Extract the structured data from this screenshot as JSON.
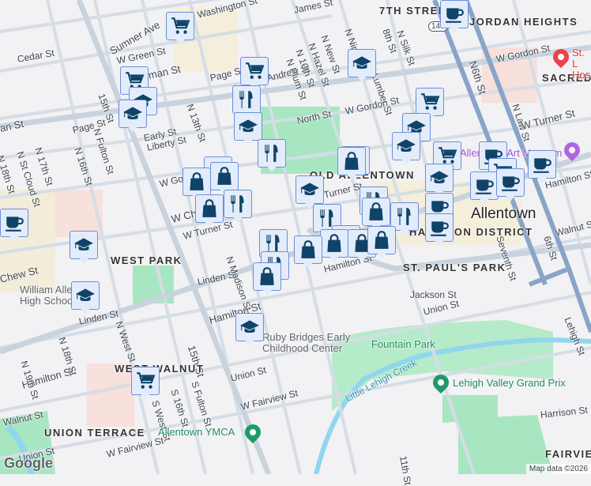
{
  "streets": {
    "james": "James St",
    "washington": "Washington St",
    "sumner": "Sumner Ave",
    "cedar": "Cedar St",
    "green": "W Green St",
    "tilghman_w": "an St",
    "tilghman_e": "man St",
    "page1": "Page St",
    "page2": "Page St",
    "andrew": "Andrew St",
    "n13": "N 13th St",
    "n15": "15th St",
    "fulton": "N Fulton St",
    "n16": "N 16th St",
    "n17": "N 17th St",
    "stcloud": "N St Cloud St",
    "n18": "N 18th St",
    "early": "Early St",
    "liberty": "Liberty St",
    "w_gordon1": "W Gordon St",
    "w_gordon2": "W Gordon St",
    "w_gordon3": "W Gordon St",
    "w_chew": "W Chew St",
    "north": "North St",
    "n_ninth": "N Ninth St",
    "n_new": "N New St",
    "n_hazel": "N Hazel St",
    "n_10th": "N 10th St",
    "n_plum": "N Plum St",
    "n_lumber": "N Lumber St",
    "n_8th": "8th St",
    "n_silk": "N Silk St",
    "n6": "N6th St",
    "n_law": "N Law St",
    "w_turner1": "W Turner St",
    "w_turner2": "W Turner St",
    "w_turner3": "Turner St",
    "hamilton1": "Hamilton St",
    "hamilton2": "Hamilton St",
    "hamilton3": "Hamilton St",
    "hamilton4": "Hamilton St",
    "chew": "Chew St",
    "linden1": "Linden St",
    "linden2": "Linden St",
    "madison": "N Madison St",
    "west_st": "N West St",
    "n19": "N 19th St",
    "n18b": "N 18th St",
    "s15": "15th St",
    "union1": "Union St",
    "union2": "Union St",
    "union3": "Union St",
    "fairview1": "W Fairview St",
    "fairview2": "W Fairview St",
    "s_west": "S West St",
    "s16": "S 16th St",
    "s_fulton": "S Fulton St",
    "walnut1": "Walnut St",
    "walnut2": "Walnut St",
    "jackson": "Jackson St",
    "seventh": "Seventh St",
    "sixth": "6th St",
    "lehigh": "Lehigh St",
    "harrison": "Harrison St",
    "eleventh": "11th St",
    "route": "145"
  },
  "neighborhoods": {
    "seventh_street": "7TH STREET",
    "jordan_heights": "JORDAN HEIGHTS",
    "sacred": "SACRED",
    "old_allentown": "OLD ALLENTOWN",
    "west_park": "WEST PARK",
    "hamilton_district": "HAMILTON DISTRICT",
    "st_pauls_park": "ST. PAUL'S PARK",
    "west_walnut": "WEST WALNUT",
    "union_terrace": "UNION TERRACE",
    "fairview": "FAIRVIEW"
  },
  "city": "Allentown",
  "places": {
    "hospital": "St. L Hos",
    "museum": "Allentown Art Museum",
    "william_allen": "William Allen High School",
    "ruby_bridges": "Ruby Bridges Early Childhood Center",
    "fountain_park": "Fountain Park",
    "little_lehigh": "Little Lehigh Creek",
    "grand_prix": "Lehigh Valley Grand Prix",
    "ymca": "Allentown YMCA"
  },
  "colors": {
    "marker_bg": "#e3ecfb",
    "marker_icon": "#0f4468",
    "park": "#a8e6c2",
    "water": "#8fd6ee",
    "road_major": "#8aa4c8"
  },
  "attribution": "Map data ©2026",
  "logo": "Google"
}
